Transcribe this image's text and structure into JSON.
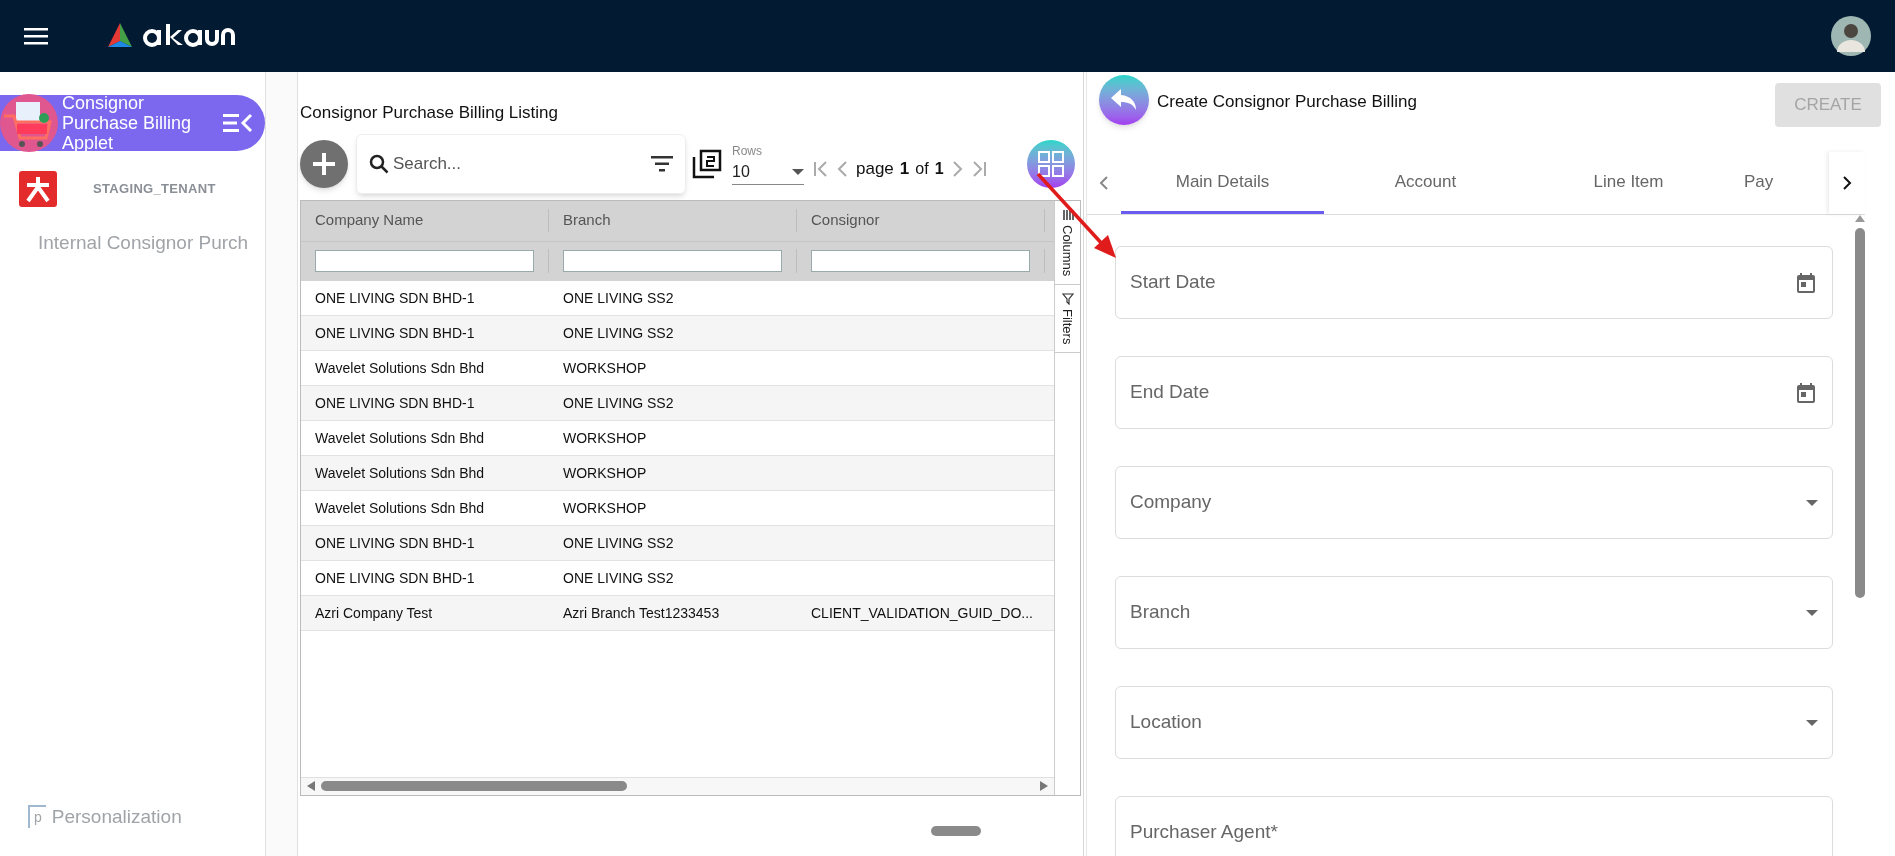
{
  "sidebar": {
    "applet": {
      "title": "Consignor Purchase Billing Applet"
    },
    "tenant": "STAGING_TENANT",
    "items": [
      {
        "label": "Internal Consignor Purch",
        "selected": false
      }
    ],
    "footer": {
      "icon_alt": "p",
      "label": "Personalization"
    }
  },
  "listing": {
    "title": "Consignor Purchase Billing Listing",
    "search": {
      "placeholder": "Search..."
    },
    "rows_label": "Rows",
    "rows_value": "10",
    "pager": {
      "word": "page",
      "page": "1",
      "of": "of",
      "total": "1"
    },
    "columns": [
      "Company Name",
      "Branch",
      "Consignor"
    ],
    "rows": [
      [
        "ONE LIVING SDN BHD-1",
        "ONE LIVING SS2",
        ""
      ],
      [
        "ONE LIVING SDN BHD-1",
        "ONE LIVING SS2",
        ""
      ],
      [
        "Wavelet Solutions Sdn Bhd",
        "WORKSHOP",
        ""
      ],
      [
        "ONE LIVING SDN BHD-1",
        "ONE LIVING SS2",
        ""
      ],
      [
        "Wavelet Solutions Sdn Bhd",
        "WORKSHOP",
        ""
      ],
      [
        "Wavelet Solutions Sdn Bhd",
        "WORKSHOP",
        ""
      ],
      [
        "Wavelet Solutions Sdn Bhd",
        "WORKSHOP",
        ""
      ],
      [
        "ONE LIVING SDN BHD-1",
        "ONE LIVING SS2",
        ""
      ],
      [
        "ONE LIVING SDN BHD-1",
        "ONE LIVING SS2",
        ""
      ],
      [
        "Azri Company Test",
        "Azri Branch Test1233453",
        "CLIENT_VALIDATION_GUID_DO..."
      ]
    ],
    "side_tabs": [
      "Columns",
      "Filters"
    ]
  },
  "form": {
    "title": "Create Consignor Purchase Billing",
    "create_button": {
      "label": "CREATE",
      "disabled": true
    },
    "tabs": [
      {
        "label": "Main Details",
        "selected": true
      },
      {
        "label": "Account",
        "selected": false
      },
      {
        "label": "Line Item",
        "selected": false
      },
      {
        "label": "Pay",
        "selected": false
      }
    ],
    "fields": [
      {
        "label": "Start Date",
        "kind": "date"
      },
      {
        "label": "End Date",
        "kind": "date"
      },
      {
        "label": "Company",
        "kind": "select"
      },
      {
        "label": "Branch",
        "kind": "select"
      },
      {
        "label": "Location",
        "kind": "select"
      },
      {
        "label": "Purchaser Agent*",
        "kind": "text"
      }
    ]
  }
}
